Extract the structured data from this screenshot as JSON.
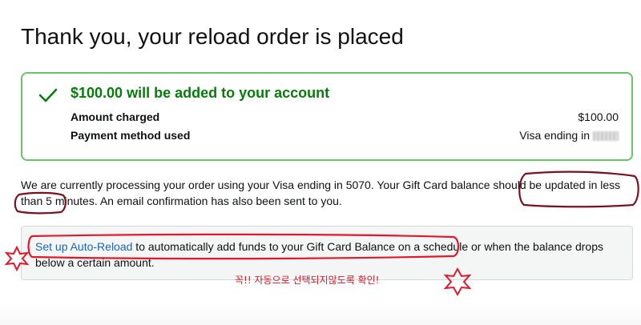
{
  "page": {
    "title": "Thank you, your reload order is placed"
  },
  "success": {
    "headline": "$100.00 will be added to your account",
    "amount_label": "Amount charged",
    "amount_value": "$100.00",
    "payment_label": "Payment method used",
    "payment_value": "Visa ending in"
  },
  "processing": {
    "text": "We are currently processing your order using your Visa ending in 5070. Your Gift Card balance should be updated in less than 5 minutes. An email confirmation has also been sent to you."
  },
  "autoreload": {
    "link_label": "Set up Auto-Reload",
    "text": " to automatically add funds to your Gift Card Balance on a schedule or when the balance drops below a certain amount."
  },
  "annotation": {
    "note": "꼭!! 자동으로 선택되지않도록 확인!",
    "color": "#d11a2a"
  },
  "colors": {
    "success_green": "#067d0a",
    "success_border": "#67c46a",
    "link_blue": "#1a66b8",
    "annotation_dark_red": "#7a1020"
  },
  "icons": {
    "success": "check-icon",
    "annotation_mark": "star-icon"
  }
}
